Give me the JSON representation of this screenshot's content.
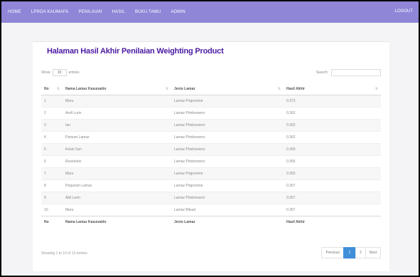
{
  "nav": {
    "items": [
      "HOME",
      "LPRDA KAUMAFA",
      "PENILAIAN",
      "HASIL",
      "BUKU TAMU",
      "ADMIN"
    ],
    "logout": "LOGOUT"
  },
  "page": {
    "title": "Halaman Hasil Akhir Penilaian Weighting Product"
  },
  "controls": {
    "show_label": "Show",
    "show_value": "10",
    "entries_label": "entries",
    "search_label": "Search:"
  },
  "table": {
    "headers": [
      "No",
      "Nama Lamaz Kasunaido",
      "Jenis Lamaz",
      "Hasil Akhir"
    ],
    "rows": [
      [
        "1",
        "Maru",
        "Lamaz Prigonome",
        "0.373"
      ],
      [
        "2",
        "Andi Lurin",
        "Lamaz Phobonsero",
        "0.362"
      ],
      [
        "3",
        "Ian",
        "Lamaz Phobonsero",
        "0.362"
      ],
      [
        "4",
        "Parsum Lamaz",
        "Lamaz Phobonsero",
        "0.362"
      ],
      [
        "5",
        "Kelah Sun",
        "Lamaz Phobonsero",
        "0.359"
      ],
      [
        "6",
        "Roselunin",
        "Lamaz Phobonsero",
        "0.355"
      ],
      [
        "7",
        "Maru",
        "Lamaz Prigonome",
        "0.355"
      ],
      [
        "8",
        "Prigunsin Lamaz",
        "Lamaz Prigonome",
        "0.357"
      ],
      [
        "9",
        "Alid Lurin",
        "Lamaz Phobonsero",
        "0.357"
      ],
      [
        "10",
        "Maru",
        "Lamaz Bikual",
        "0.357"
      ]
    ]
  },
  "footer": {
    "info": "Showing 1 to 10 of 13 entries",
    "prev": "Previous",
    "pages": [
      "1",
      "2"
    ],
    "active_page": "1",
    "next": "Next"
  }
}
